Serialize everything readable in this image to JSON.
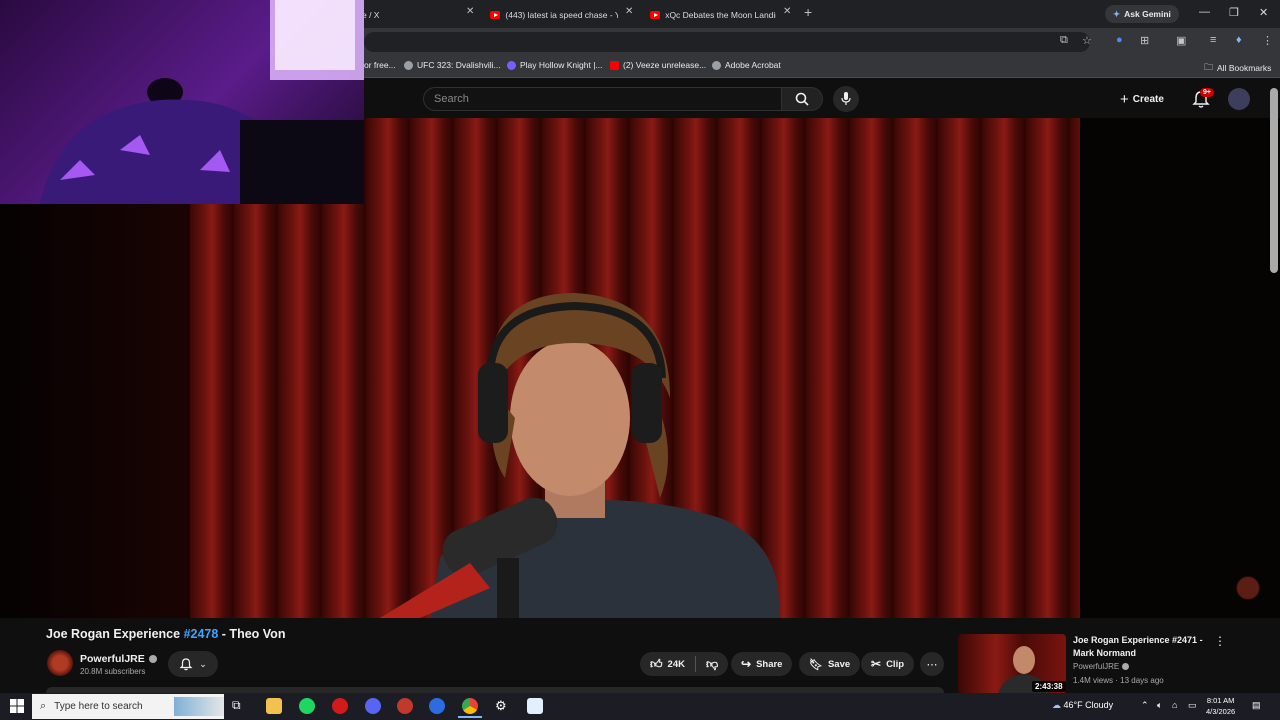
{
  "browser": {
    "tabs": [
      {
        "label": "e / X",
        "site": "x"
      },
      {
        "label": "(443) latest ia speed chase - Yo",
        "site": "youtube"
      },
      {
        "label": "xQc Debates the Moon Landing",
        "site": "youtube"
      }
    ],
    "gemini_label": "Ask Gemini",
    "bookmarks": [
      {
        "label": "or free..."
      },
      {
        "label": "UFC 323: Dvalishvili..."
      },
      {
        "label": "Play Hollow Knight |..."
      },
      {
        "label": "(2) Veeze unrelease..."
      },
      {
        "label": "Adobe Acrobat"
      }
    ],
    "all_bookmarks_label": "All Bookmarks"
  },
  "youtube": {
    "search_placeholder": "Search",
    "create_label": "Create",
    "notification_count": "9+"
  },
  "video": {
    "title_prefix": "Joe Rogan Experience ",
    "title_tag": "#2478",
    "title_suffix": " - Theo Von",
    "channel": "PowerfulJRE",
    "subscribers": "20.8M subscribers",
    "likes": "24K",
    "share_label": "Share",
    "save_label": "Save",
    "clip_label": "Clip"
  },
  "recommended": {
    "title": "Joe Rogan Experience #2471 - Mark Normand",
    "channel": "PowerfulJRE",
    "meta": "1.4M views · 13 days ago",
    "duration": "2:43:38"
  },
  "taskbar": {
    "search_placeholder": "Type here to search",
    "weather": "46°F  Cloudy",
    "time": "8:01 AM",
    "date": "4/3/2026"
  },
  "colors": {
    "youtube_red": "#ff0000",
    "link_blue": "#3ea6ff",
    "background": "#0f0f0f"
  }
}
